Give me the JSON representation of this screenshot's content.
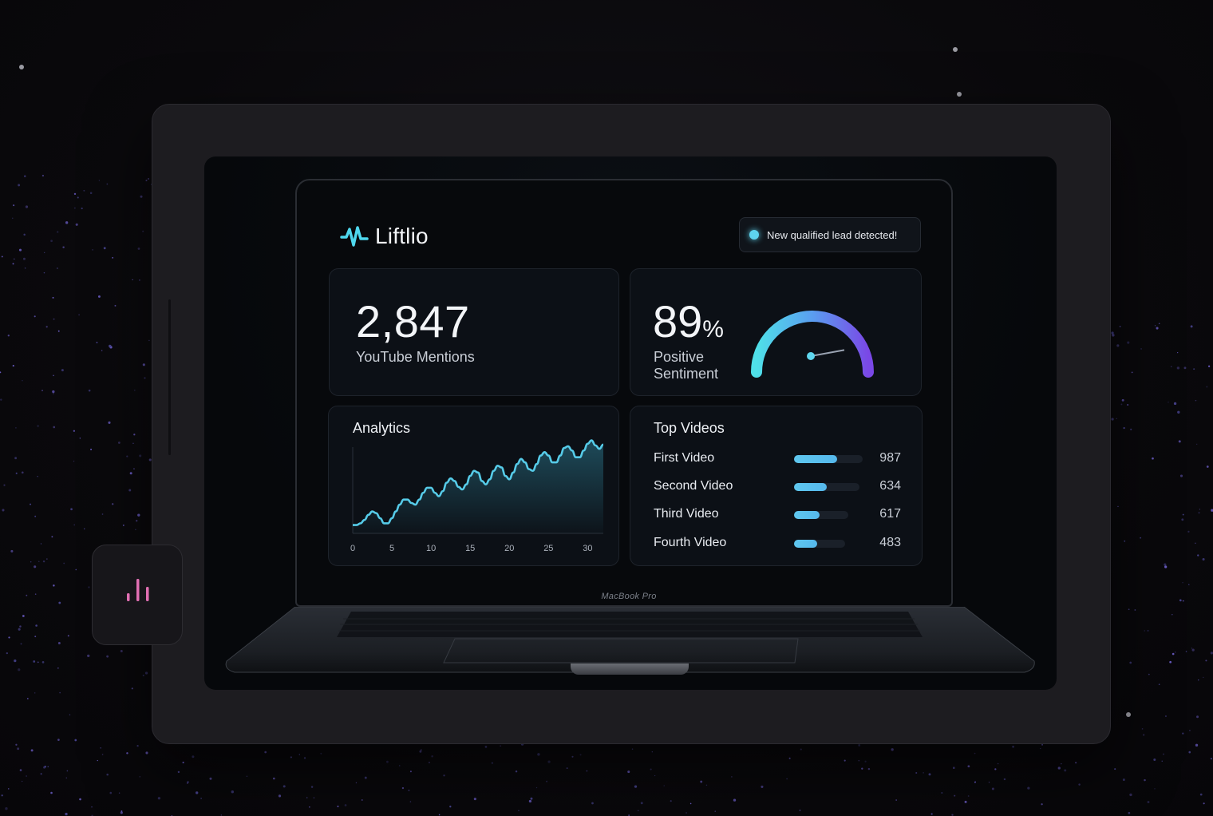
{
  "brand": {
    "name": "Liftlio",
    "logo_icon": "waveform-icon",
    "accent": "#4fd8ee"
  },
  "notification": {
    "text": "New qualified lead detected!",
    "status_color": "#5ed4ee"
  },
  "mentions": {
    "value": "2,847",
    "label": "YouTube Mentions"
  },
  "sentiment": {
    "value": "89",
    "unit": "%",
    "label": "Positive Sentiment",
    "gauge_level": 0.89
  },
  "analytics": {
    "title": "Analytics"
  },
  "top_videos": {
    "title": "Top Videos",
    "items": [
      {
        "name": "First Video",
        "value": "987",
        "fill": 0.63
      },
      {
        "name": "Second Video",
        "value": "634",
        "fill": 0.5
      },
      {
        "name": "Third Video",
        "value": "617",
        "fill": 0.47
      },
      {
        "name": "Fourth Video",
        "value": "483",
        "fill": 0.46
      }
    ]
  },
  "device": {
    "label": "MacBook Pro"
  },
  "side_app": {
    "icon": "bar-chart-icon",
    "color": "#e06fb2"
  },
  "chart_data": {
    "type": "area",
    "title": "Analytics",
    "xlabel": "",
    "ylabel": "",
    "x_ticks": [
      "0",
      "5",
      "10",
      "15",
      "20",
      "25",
      "30"
    ],
    "xlim": [
      0,
      32
    ],
    "ylim": [
      0,
      100
    ],
    "grid": false,
    "series": [
      {
        "x": [
          0,
          0.5,
          1,
          1.5,
          2,
          2.5,
          3,
          3.5,
          4,
          4.5,
          5,
          5.5,
          6,
          6.5,
          7,
          7.5,
          8,
          8.5,
          9,
          9.5,
          10,
          10.5,
          11,
          11.5,
          12,
          12.5,
          13,
          13.5,
          14,
          14.5,
          15,
          15.5,
          16,
          16.5,
          17,
          17.5,
          18,
          18.5,
          19,
          19.5,
          20,
          20.5,
          21,
          21.5,
          22,
          22.5,
          23,
          23.5,
          24,
          24.5,
          25,
          25.5,
          26,
          26.5,
          27,
          27.5,
          28,
          28.5,
          29,
          29.5,
          30,
          30.5,
          31,
          31.5,
          32
        ],
        "y": [
          8,
          8,
          10,
          14,
          20,
          24,
          22,
          16,
          10,
          10,
          16,
          24,
          32,
          38,
          38,
          34,
          32,
          38,
          46,
          52,
          52,
          46,
          42,
          48,
          58,
          63,
          60,
          53,
          50,
          56,
          66,
          72,
          70,
          60,
          56,
          62,
          72,
          78,
          76,
          66,
          62,
          70,
          80,
          86,
          82,
          74,
          72,
          80,
          90,
          94,
          90,
          82,
          82,
          90,
          99,
          101,
          96,
          88,
          88,
          96,
          104,
          108,
          102,
          98,
          103
        ]
      }
    ]
  }
}
